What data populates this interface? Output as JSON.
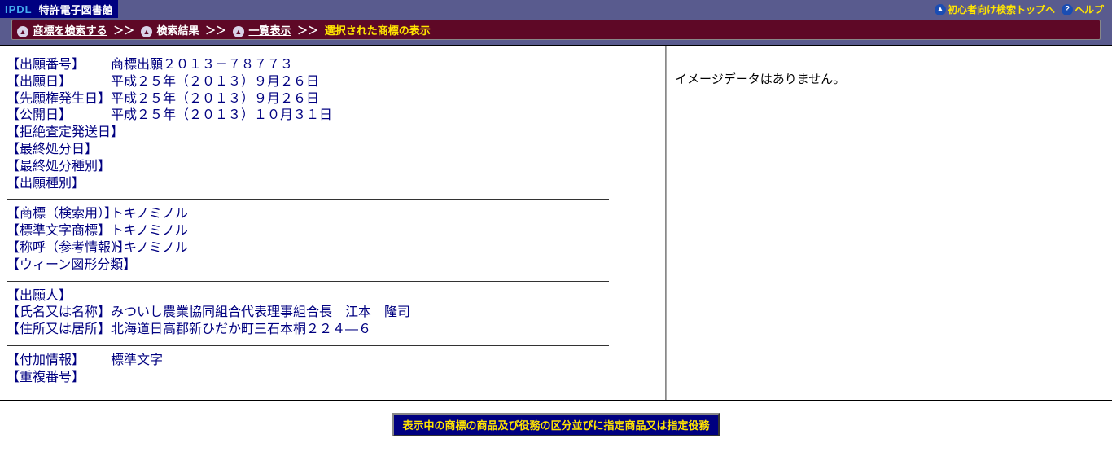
{
  "header": {
    "brand_abbr": "IPDL",
    "brand_title": "特許電子図書館",
    "beginner_link": "初心者向け検索トップへ",
    "help_link": "ヘルプ"
  },
  "breadcrumb": {
    "search": "商標を検索する",
    "results": "検索結果",
    "list": "一覧表示",
    "current": "選択された商標の表示",
    "sep": "＞＞"
  },
  "detail": {
    "appnum_label": "【出願番号】",
    "appnum_value": "商標出願２０１３－７８７７３",
    "appdate_label": "【出願日】",
    "appdate_value": "平成２５年（２０１３）９月２６日",
    "priordate_label": "【先願権発生日】",
    "priordate_value": "平成２５年（２０１３）９月２６日",
    "pubdate_label": "【公開日】",
    "pubdate_value": "平成２５年（２０１３）１０月３１日",
    "rejsend_label": "【拒絶査定発送日】",
    "finaldate_label": "【最終処分日】",
    "finaltype_label": "【最終処分種別】",
    "apptype_label": "【出願種別】",
    "search_tm_label": "【商標（検索用）】",
    "search_tm_value": "トキノミノル",
    "std_tm_label": "【標準文字商標】",
    "std_tm_value": "トキノミノル",
    "call_label": "【称呼（参考情報）】",
    "call_value": "トキノミノル",
    "vienna_label": "【ウィーン図形分類】",
    "applicant_label": "【出願人】",
    "name_label": "【氏名又は名称】",
    "name_value": "みついし農業協同組合代表理事組合長　江本　隆司",
    "addr_label": "【住所又は居所】",
    "addr_value": "北海道日高郡新ひだか町三石本桐２２４―６",
    "addinfo_label": "【付加情報】",
    "addinfo_value": "標準文字",
    "dupnum_label": "【重複番号】"
  },
  "right": {
    "no_image": "イメージデータはありません。"
  },
  "footer": {
    "button": "表示中の商標の商品及び役務の区分並びに指定商品又は指定役務"
  }
}
